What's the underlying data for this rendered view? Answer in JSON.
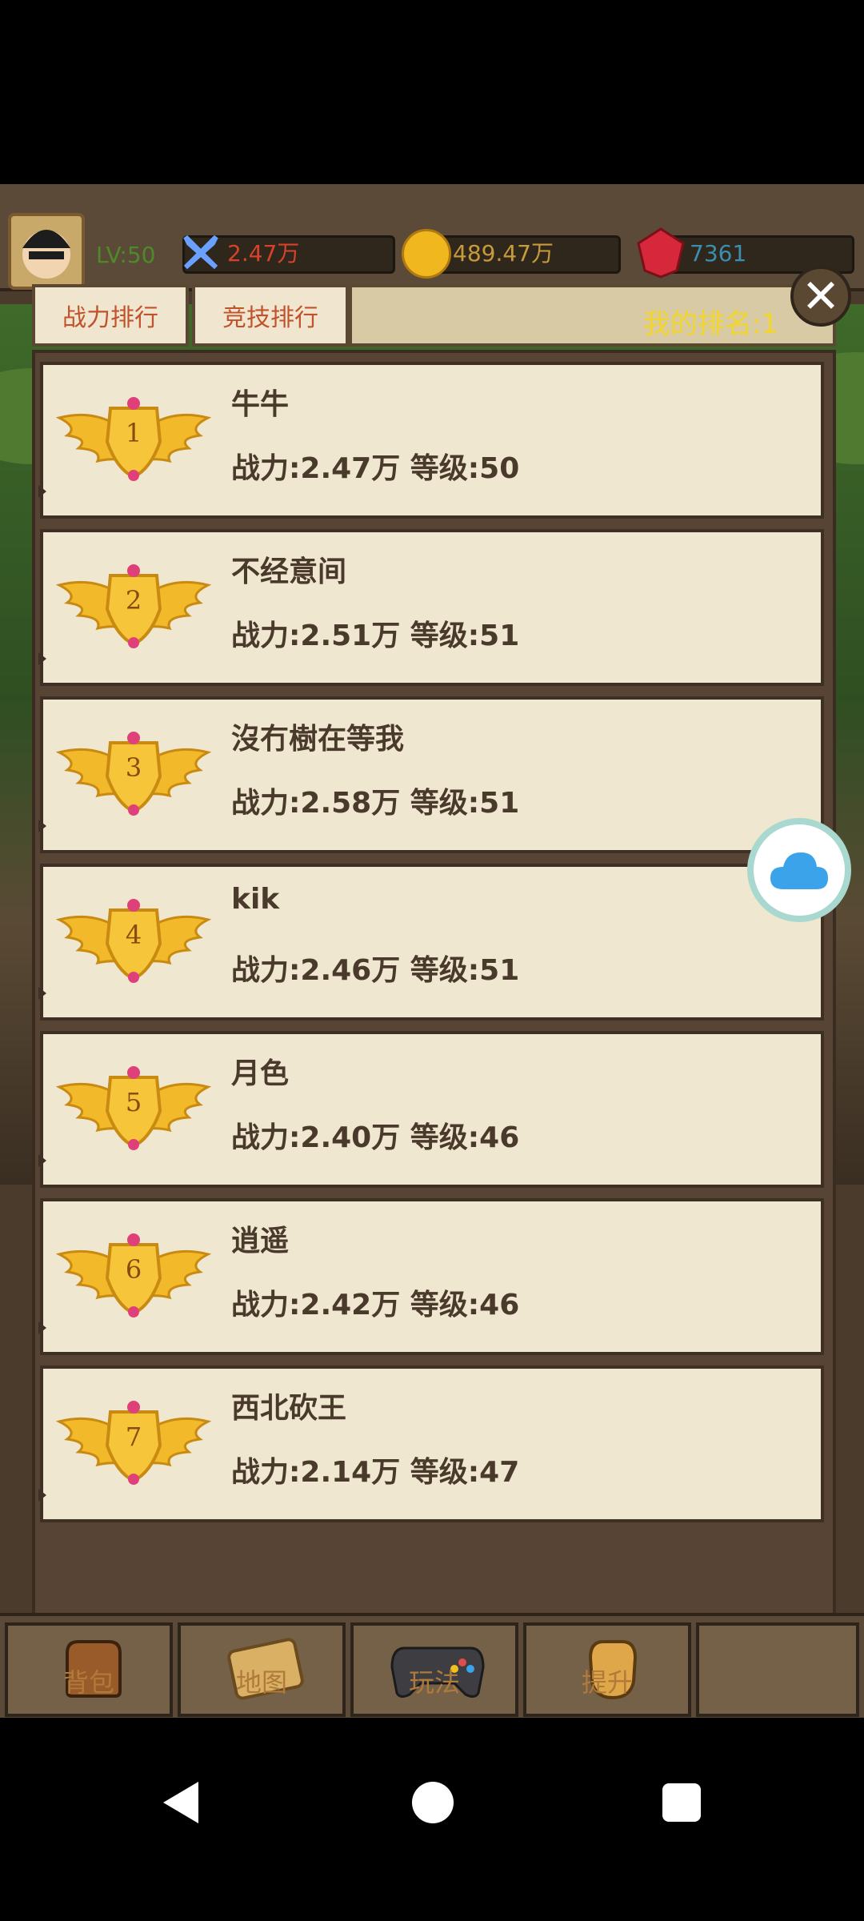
{
  "hud": {
    "level": "LV:50",
    "power": "2.47万",
    "gold": "489.47万",
    "gems": "7361"
  },
  "ranking": {
    "tabs": [
      "战力排行",
      "竞技排行"
    ],
    "my_rank": "我的排名:1",
    "entries": [
      {
        "rank": "1",
        "name": "牛牛",
        "stats": "战力:2.47万 等级:50"
      },
      {
        "rank": "2",
        "name": "不经意间",
        "stats": "战力:2.51万 等级:51"
      },
      {
        "rank": "3",
        "name": "沒冇樹在等我",
        "stats": "战力:2.58万 等级:51"
      },
      {
        "rank": "4",
        "name": "kik",
        "stats": "战力:2.46万 等级:51"
      },
      {
        "rank": "5",
        "name": "月色",
        "stats": "战力:2.40万 等级:46"
      },
      {
        "rank": "6",
        "name": "逍遥",
        "stats": "战力:2.42万 等级:46"
      },
      {
        "rank": "7",
        "name": "西北砍王",
        "stats": "战力:2.14万 等级:47"
      }
    ]
  },
  "bottom_nav": [
    "背包",
    "地图",
    "玩法",
    "提升"
  ],
  "colors": {
    "panel": "#574434",
    "row": "#f0e7d0",
    "tab_text": "#c0522c",
    "my_rank": "#f3d62a",
    "text": "#4a3a2b"
  }
}
